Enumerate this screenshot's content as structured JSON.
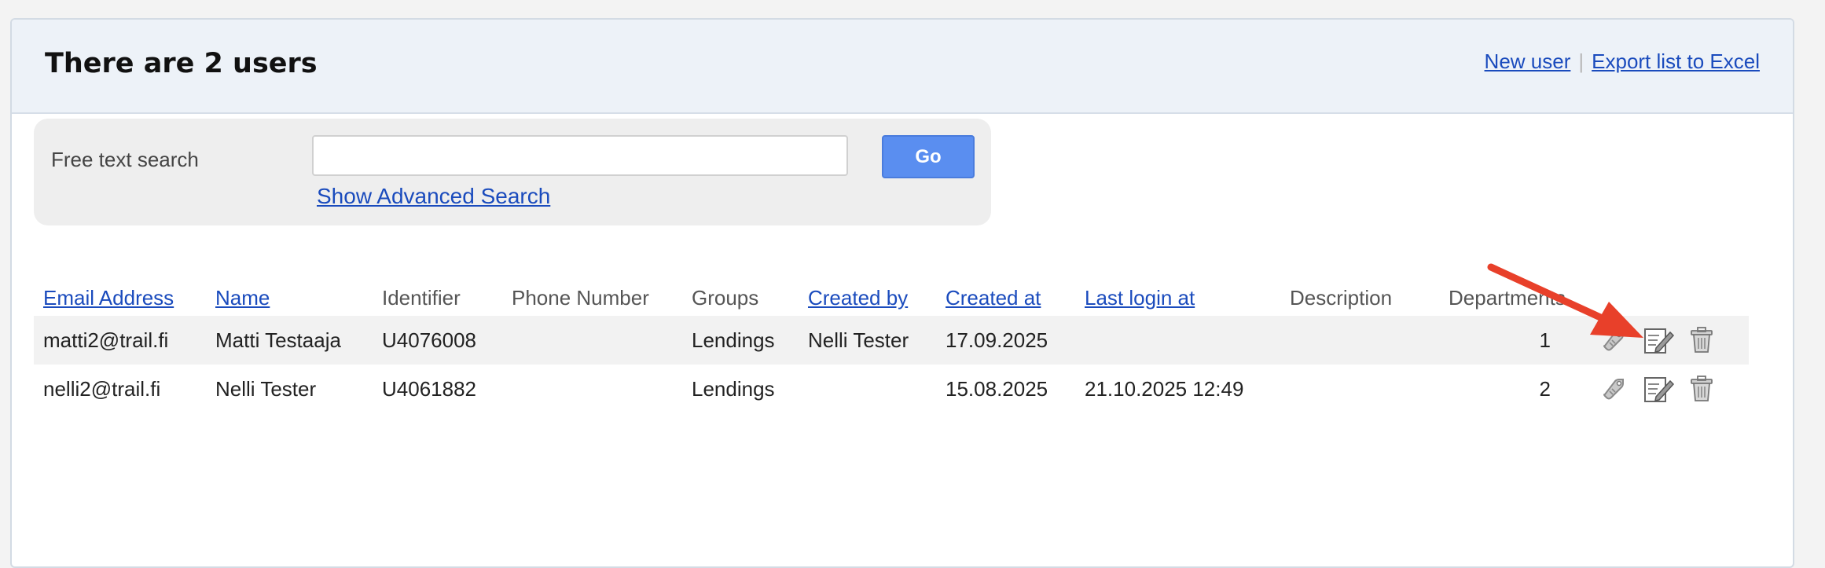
{
  "header": {
    "title": "There are 2 users",
    "new_user_link": "New user",
    "separator": "|",
    "export_link": "Export list to Excel"
  },
  "search": {
    "label": "Free text search",
    "value": "",
    "go_label": "Go",
    "advanced_link": "Show Advanced Search"
  },
  "table": {
    "columns": {
      "email": "Email Address",
      "name": "Name",
      "identifier": "Identifier",
      "phone": "Phone Number",
      "groups": "Groups",
      "created_by": "Created by",
      "created_at": "Created at",
      "last_login": "Last login at",
      "description": "Description",
      "departments": "Departments"
    },
    "rows": [
      {
        "email": "matti2@trail.fi",
        "name": "Matti Testaaja",
        "identifier": "U4076008",
        "phone": "",
        "groups": "Lendings",
        "created_by": "Nelli Tester",
        "created_at": "17.09.2025",
        "last_login": "",
        "description": "",
        "departments": "1"
      },
      {
        "email": "nelli2@trail.fi",
        "name": "Nelli Tester",
        "identifier": "U4061882",
        "phone": "",
        "groups": "Lendings",
        "created_by": "",
        "created_at": "15.08.2025",
        "last_login": "21.10.2025 12:49",
        "description": "",
        "departments": "2"
      }
    ],
    "row_action_icons": [
      "tag-icon",
      "edit-icon",
      "trash-icon"
    ]
  },
  "colors": {
    "link": "#1a4bbd",
    "go_button": "#5a8ef0",
    "annotation_arrow": "#e8402a"
  }
}
